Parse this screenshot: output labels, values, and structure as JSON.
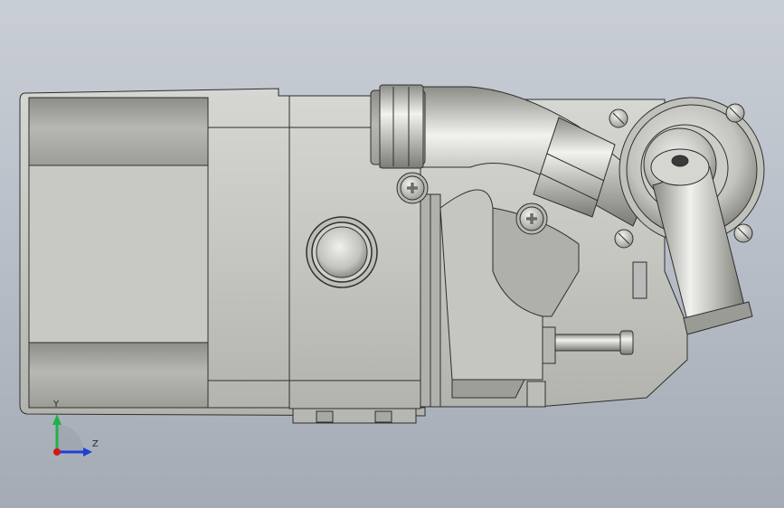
{
  "viewport": {
    "background_top": "#c9ced6",
    "background_bottom": "#a5abb5"
  },
  "model": {
    "body_color": "#c4c4bf",
    "edge_color": "#2e2e2e",
    "tube_color": "#b9b9b4"
  },
  "triad": {
    "y_label": "Y",
    "z_label": "Z",
    "y_color": "#22b04a",
    "z_color": "#1f3fd6",
    "x_color": "#d01818"
  }
}
